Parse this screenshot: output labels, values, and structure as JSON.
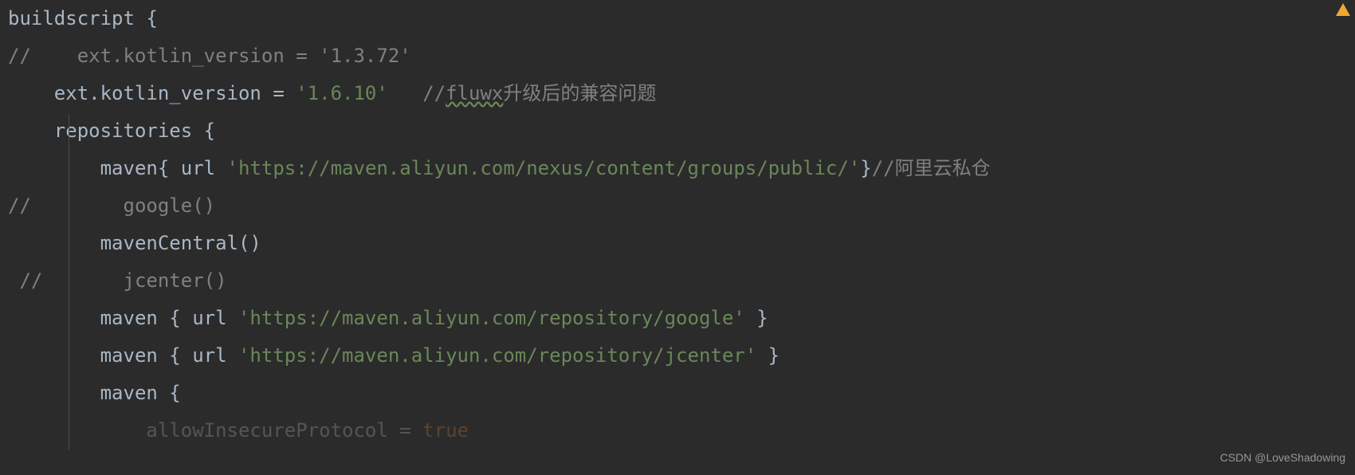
{
  "code": {
    "line1": {
      "text": "buildscript {"
    },
    "line2": {
      "prefix": "//    ext.kotlin_version = '1.3.72'"
    },
    "line3": {
      "indent": "    ",
      "text1": "ext.kotlin_version = ",
      "string": "'1.6.10'",
      "spacer": "   ",
      "comment_slash": "//",
      "comment_underl": "fluwx",
      "comment_rest": "升级后的兼容问题"
    },
    "line4": {
      "indent": "    ",
      "text": "repositories {"
    },
    "line5": {
      "indent": "        ",
      "text1": "maven{ url ",
      "string": "'https://maven.aliyun.com/nexus/content/groups/public/'",
      "text2": "}",
      "comment": "//阿里云私仓"
    },
    "line6": {
      "prefix": "//        google()"
    },
    "line7": {
      "indent": "        ",
      "text": "mavenCentral()"
    },
    "line8": {
      "prefix": " //       jcenter()"
    },
    "line9": {
      "indent": "        ",
      "text1": "maven { url ",
      "string": "'https://maven.aliyun.com/repository/google'",
      "text2": " }"
    },
    "line10": {
      "indent": "        ",
      "text1": "maven { url ",
      "string": "'https://maven.aliyun.com/repository/jcenter'",
      "text2": " }"
    },
    "line11": {
      "indent": "        ",
      "text": "maven {"
    },
    "line12": {
      "indent": "            ",
      "partial": "allowInsecureProtocol = ",
      "value": "true"
    }
  },
  "watermark": "CSDN @LoveShadowing"
}
